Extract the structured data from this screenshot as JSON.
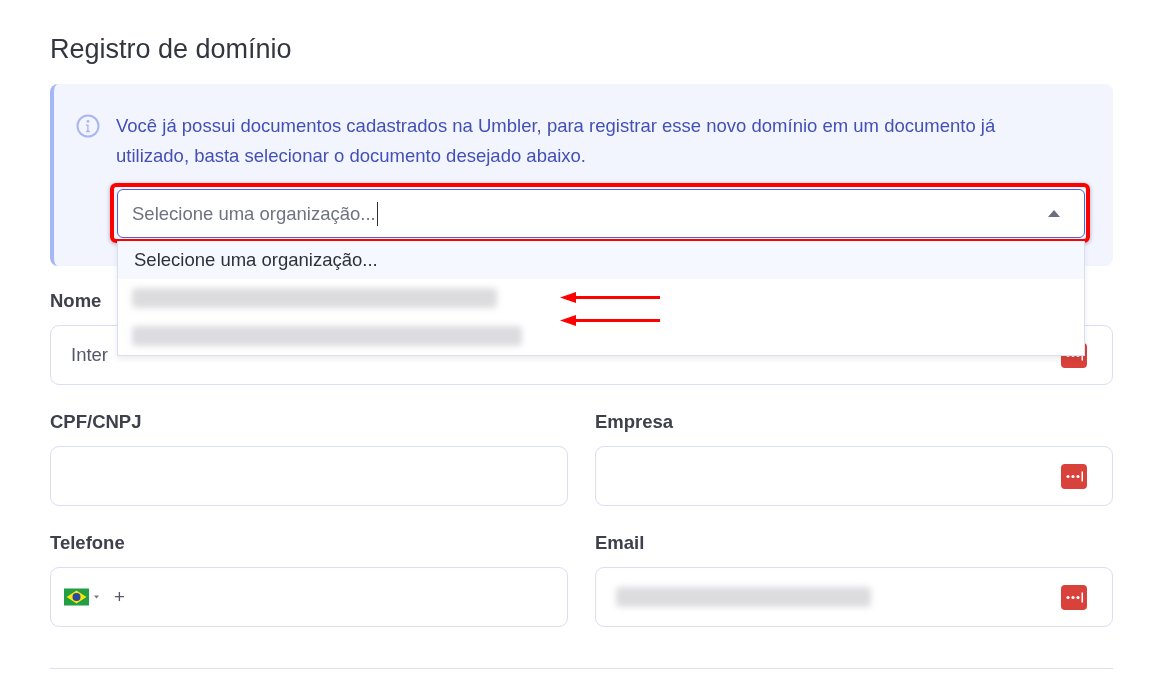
{
  "title": "Registro de domínio",
  "notice": {
    "text": "Você já possui documentos cadastrados na Umbler, para registrar esse novo domínio em um documento já utilizado, basta selecionar o documento desejado abaixo.",
    "select": {
      "placeholder": "Selecione uma organização...",
      "expanded": true,
      "highlighted": true,
      "options": [
        {
          "kind": "text",
          "label": "Selecione uma organização...",
          "selected": true
        },
        {
          "kind": "blurred",
          "selected": false
        },
        {
          "kind": "blurred",
          "selected": false
        }
      ]
    }
  },
  "fields": [
    {
      "kind": "text",
      "label": "Nome",
      "value": "Inter",
      "manager_icon": true
    },
    {
      "kind": "text",
      "label": "CPF/CNPJ",
      "manager_icon": false
    },
    {
      "kind": "text",
      "label": "Empresa",
      "manager_icon": true
    },
    {
      "kind": "phone",
      "label": "Telefone",
      "value": "+",
      "manager_icon": false
    },
    {
      "kind": "blurred",
      "label": "Email",
      "manager_icon": true
    }
  ]
}
